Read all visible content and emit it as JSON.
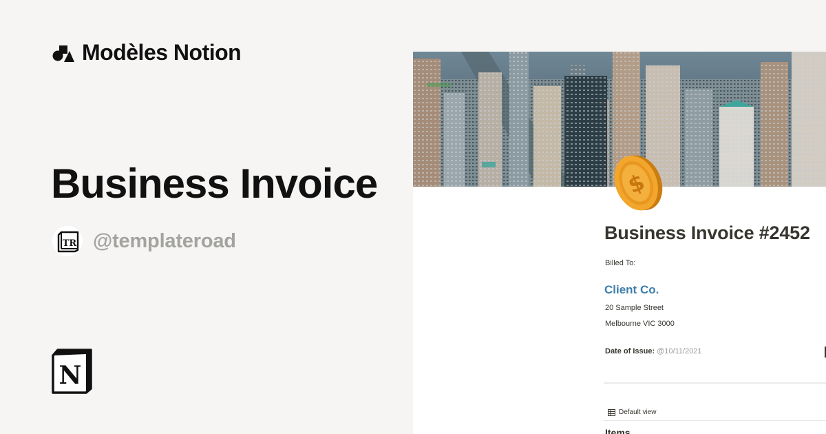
{
  "brand": {
    "name": "Modèles Notion",
    "logo_icon": "shapes-logo-icon"
  },
  "hero": {
    "title": "Business Invoice"
  },
  "author": {
    "handle": "@templateroad",
    "avatar_text": "TR"
  },
  "notion_logo": {
    "icon": "notion-logo-icon",
    "letter": "N"
  },
  "preview": {
    "cover_image": "city-skyline-cover",
    "page_icon": "gold-coin-icon",
    "page_icon_symbol": "$",
    "title": "Business Invoice #2452",
    "billed_to_label": "Billed To:",
    "client_name": "Client Co.",
    "address_line1": "20 Sample Street",
    "address_line2": "Melbourne VIC 3000",
    "date_label": "Date of Issue:",
    "date_value": "@10/11/2021",
    "view_tab_label": "Default view",
    "view_tab_icon": "table-icon",
    "items_heading": "Items"
  },
  "colors": {
    "background": "#f6f5f4",
    "text_dark": "#111111",
    "handle_gray": "#a3a3a0",
    "client_link_blue": "#3e7eab",
    "notion_text": "#37352f",
    "date_gray": "#9b9a97",
    "coin_gold": "#f2a62c"
  }
}
